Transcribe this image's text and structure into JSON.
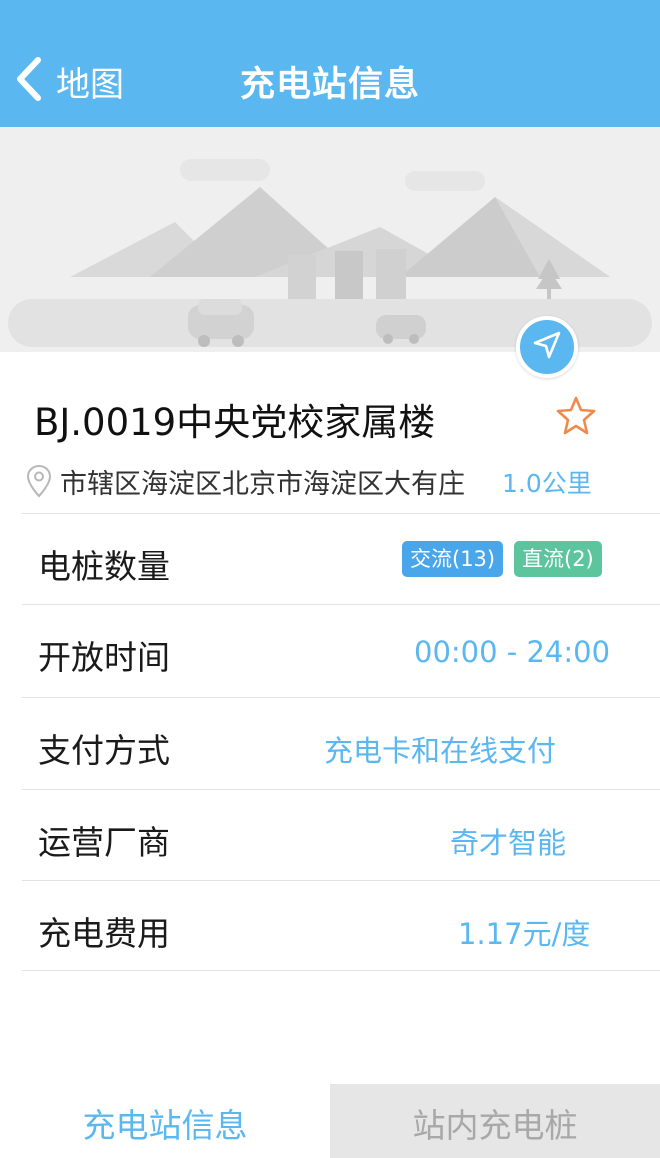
{
  "header": {
    "back_label": "地图",
    "title": "充电站信息"
  },
  "station": {
    "name": "BJ.0019中央党校家属楼",
    "address": "市辖区海淀区北京市海淀区大有庄",
    "distance": "1.0公里"
  },
  "details": {
    "piles": {
      "label": "电桩数量",
      "ac_badge": "交流(13)",
      "dc_badge": "直流(2)"
    },
    "hours": {
      "label": "开放时间",
      "value": "00:00 - 24:00"
    },
    "payment": {
      "label": "支付方式",
      "value": "充电卡和在线支付"
    },
    "operator": {
      "label": "运营厂商",
      "value": "奇才智能"
    },
    "fee": {
      "label": "充电费用",
      "value": "1.17元/度"
    }
  },
  "tabs": [
    {
      "label": "充电站信息",
      "active": true
    },
    {
      "label": "站内充电桩",
      "active": false
    }
  ],
  "icons": {
    "back": "chevron-left-icon",
    "navigate": "navigation-arrow-icon",
    "favorite": "star-outline-icon",
    "location": "map-pin-icon"
  },
  "colors": {
    "accent": "#5bb7f0",
    "ac_badge": "#4aa6ea",
    "dc_badge": "#5cc59e",
    "favorite": "#f08a4b"
  }
}
